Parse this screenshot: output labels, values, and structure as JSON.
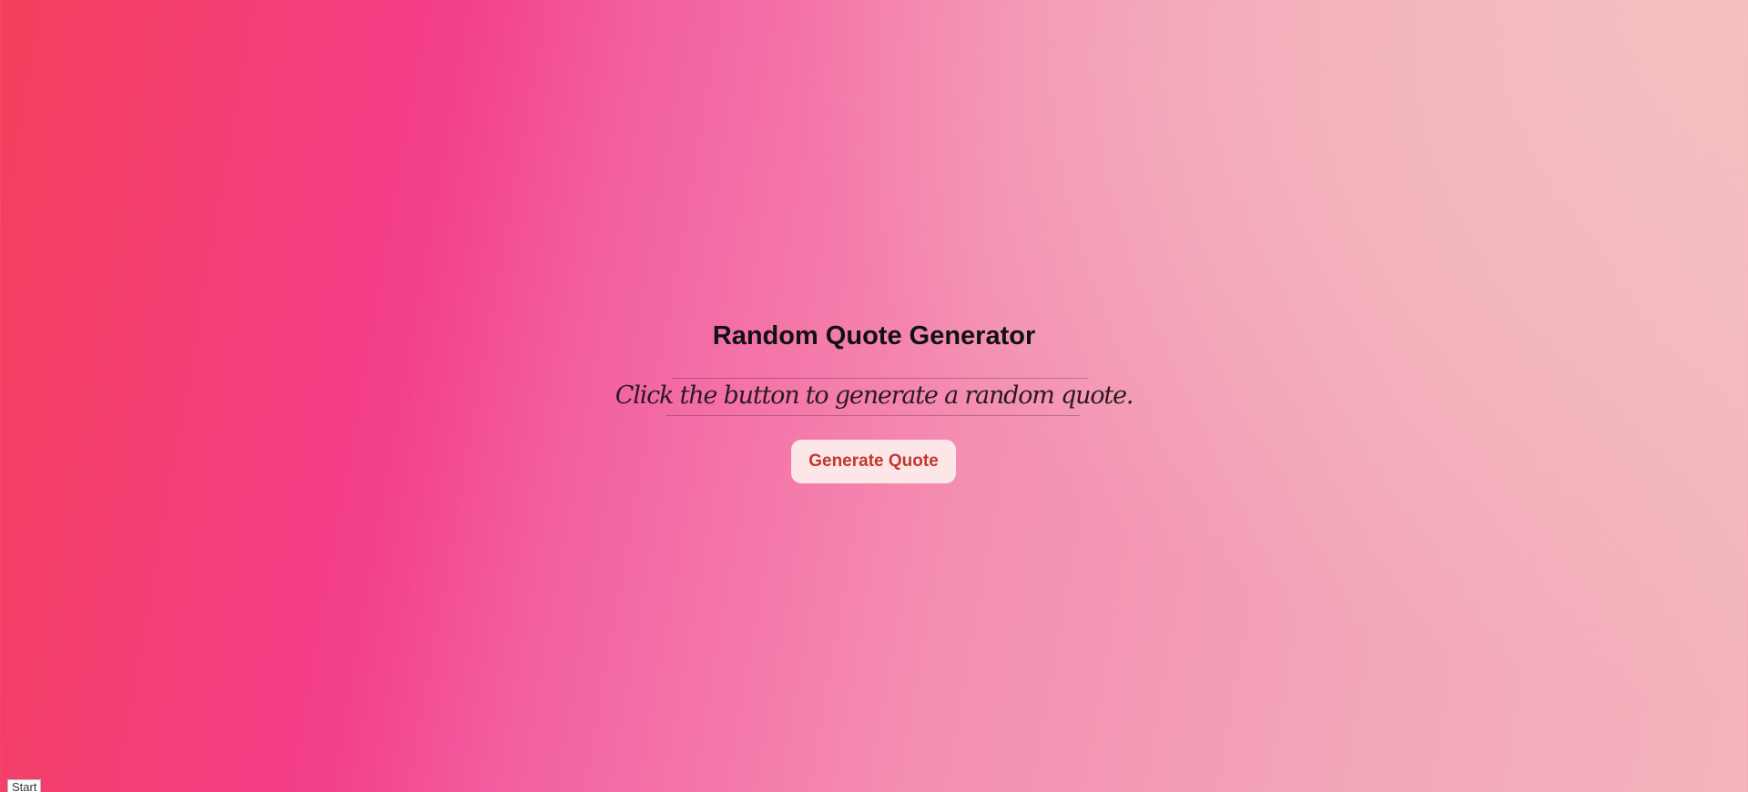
{
  "page": {
    "title": "Random Quote Generator",
    "quote": "Click the button to generate a random quote.",
    "button_label": "Generate Quote"
  },
  "footer": {
    "start_label": "Start"
  },
  "colors": {
    "gradient_left": "#f33f5b",
    "gradient_mid": "#f33e8a",
    "gradient_right": "#f3b5bd",
    "button_bg": "#fde6e8",
    "button_text": "#c0392b"
  }
}
